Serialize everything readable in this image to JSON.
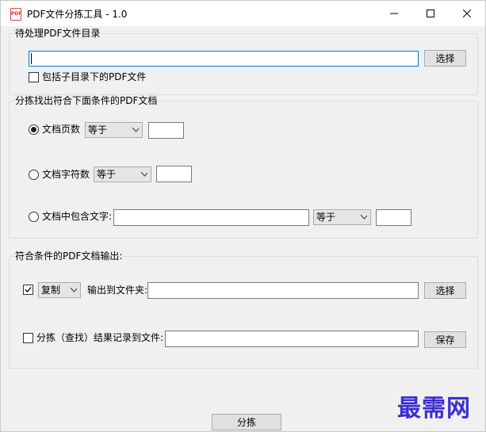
{
  "window": {
    "title": "PDF文件分拣工具 - 1.0",
    "app_icon_text": "PDF"
  },
  "source_group": {
    "legend": "待处理PDF文件目录",
    "path_value": "",
    "browse_label": "选择",
    "include_subdirs_label": "包括子目录下的PDF文件",
    "include_subdirs_checked": false
  },
  "criteria_group": {
    "legend": "分拣找出符合下面条件的PDF文档",
    "page_count": {
      "label": "文档页数",
      "selected": true,
      "operator": "等于",
      "value": ""
    },
    "char_count": {
      "label": "文档字符数",
      "selected": false,
      "operator": "等于",
      "value": ""
    },
    "contains_text": {
      "label": "文档中包含文字:",
      "selected": false,
      "text_value": "",
      "operator": "等于",
      "value": ""
    }
  },
  "output_group": {
    "legend": "符合条件的PDF文档输出:",
    "enabled_checked": true,
    "action": "复制",
    "output_label": "输出到文件夹:",
    "output_value": "",
    "output_browse_label": "选择",
    "log_checked": false,
    "log_label": "分拣（查找）结果记录到文件:",
    "log_value": "",
    "save_label": "保存"
  },
  "run_button_label": "分拣",
  "watermark": "最需网"
}
